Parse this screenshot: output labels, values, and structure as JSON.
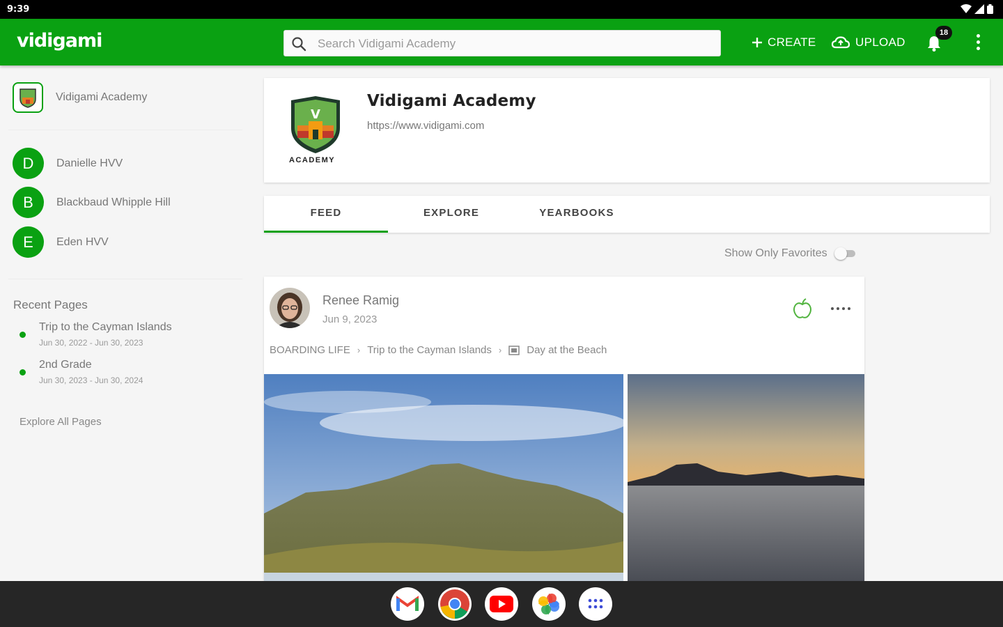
{
  "status_bar": {
    "time": "9:39"
  },
  "app_bar": {
    "logo": "vidigami",
    "search_placeholder": "Search Vidigami Academy",
    "create_label": "CREATE",
    "upload_label": "UPLOAD",
    "notification_count": "18"
  },
  "sidebar": {
    "org_name": "Vidigami Academy",
    "members": [
      {
        "initial": "D",
        "name": "Danielle HVV"
      },
      {
        "initial": "B",
        "name": "Blackbaud Whipple Hill"
      },
      {
        "initial": "E",
        "name": "Eden HVV"
      }
    ],
    "recent_heading": "Recent Pages",
    "recent_pages": [
      {
        "title": "Trip to the Cayman Islands",
        "dates": "Jun 30, 2022 - Jun 30, 2023"
      },
      {
        "title": "2nd Grade",
        "dates": "Jun 30, 2023 - Jun 30, 2024"
      }
    ],
    "explore_all": "Explore All Pages"
  },
  "school": {
    "name": "Vidigami Academy",
    "url": "https://www.vidigami.com",
    "crest_text": "ACADEMY",
    "crest_letter": "V"
  },
  "tabs": [
    {
      "label": "FEED",
      "active": true
    },
    {
      "label": "EXPLORE",
      "active": false
    },
    {
      "label": "YEARBOOKS",
      "active": false
    }
  ],
  "favorites_toggle": {
    "label": "Show Only Favorites",
    "on": false
  },
  "post": {
    "author": "Renee Ramig",
    "date": "Jun 9, 2023",
    "breadcrumb": [
      "BOARDING LIFE",
      "Trip to the Cayman Islands",
      "Day at the Beach"
    ]
  },
  "dock": {
    "apps": [
      "gmail-icon",
      "chrome-icon",
      "youtube-icon",
      "photos-icon",
      "app-drawer-icon"
    ]
  },
  "colors": {
    "brand_green": "#0aa112"
  }
}
